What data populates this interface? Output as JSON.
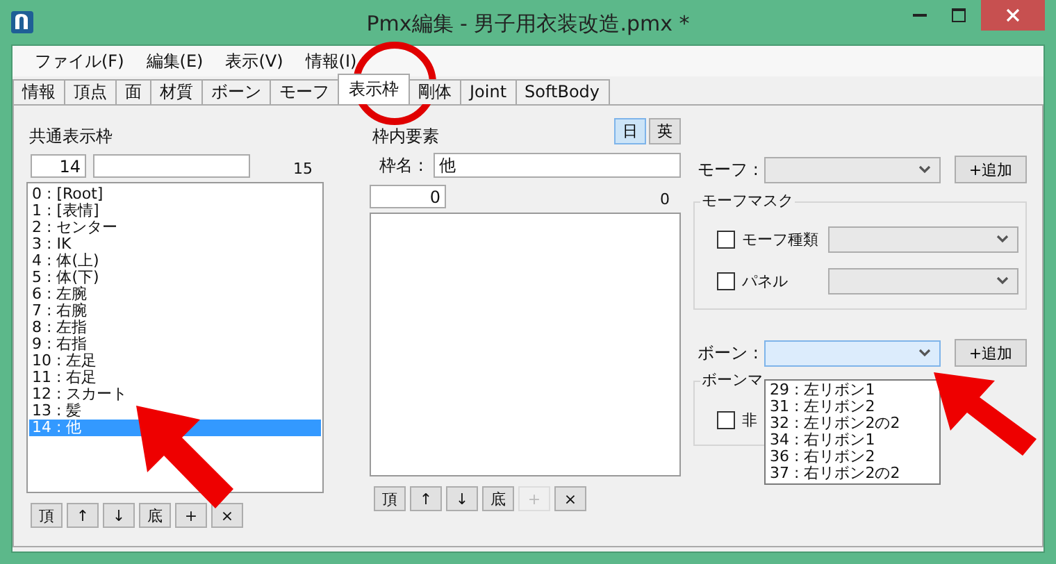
{
  "window": {
    "title": "Pmx編集 - 男子用衣装改造.pmx *"
  },
  "menu": [
    "ファイル(F)",
    "編集(E)",
    "表示(V)",
    "情報(I)"
  ],
  "tabs": [
    {
      "label": "情報",
      "selected": false
    },
    {
      "label": "頂点",
      "selected": false
    },
    {
      "label": "面",
      "selected": false
    },
    {
      "label": "材質",
      "selected": false
    },
    {
      "label": "ボーン",
      "selected": false
    },
    {
      "label": "モーフ",
      "selected": false
    },
    {
      "label": "表示枠",
      "selected": true
    },
    {
      "label": "剛体",
      "selected": false
    },
    {
      "label": "Joint",
      "selected": false
    },
    {
      "label": "SoftBody",
      "selected": false
    }
  ],
  "frame_list": {
    "title": "共通表示枠",
    "index": "14",
    "count": "15",
    "items": [
      {
        "label": "0 : [Root]",
        "selected": false
      },
      {
        "label": "1 : [表情]",
        "selected": false
      },
      {
        "label": "2 : センター",
        "selected": false
      },
      {
        "label": "3 : IK",
        "selected": false
      },
      {
        "label": "4 : 体(上)",
        "selected": false
      },
      {
        "label": "5 : 体(下)",
        "selected": false
      },
      {
        "label": "6 : 左腕",
        "selected": false
      },
      {
        "label": "7 : 右腕",
        "selected": false
      },
      {
        "label": "8 : 左指",
        "selected": false
      },
      {
        "label": "9 : 右指",
        "selected": false
      },
      {
        "label": "10 : 左足",
        "selected": false
      },
      {
        "label": "11 : 右足",
        "selected": false
      },
      {
        "label": "12 : スカート",
        "selected": false
      },
      {
        "label": "13 : 髪",
        "selected": false
      },
      {
        "label": "14 : 他",
        "selected": true
      }
    ],
    "buttons": [
      {
        "label": "頂",
        "disabled": false
      },
      {
        "label": "↑",
        "disabled": false
      },
      {
        "label": "↓",
        "disabled": false
      },
      {
        "label": "底",
        "disabled": false
      },
      {
        "label": "+",
        "disabled": false
      },
      {
        "label": "×",
        "disabled": false
      }
    ]
  },
  "element_list": {
    "title": "枠内要素",
    "lang_buttons": [
      {
        "label": "日",
        "selected": true
      },
      {
        "label": "英",
        "selected": false
      }
    ],
    "name_label": "枠名 :",
    "name_value": "他",
    "index": "0",
    "count": "0",
    "buttons": [
      {
        "label": "頂",
        "disabled": false
      },
      {
        "label": "↑",
        "disabled": false
      },
      {
        "label": "↓",
        "disabled": false
      },
      {
        "label": "底",
        "disabled": false
      },
      {
        "label": "+",
        "disabled": true
      },
      {
        "label": "×",
        "disabled": false
      }
    ]
  },
  "morph": {
    "label": "モーフ :",
    "add": "+追加"
  },
  "morph_mask": {
    "title": "モーフマスク",
    "rows": [
      {
        "label": "モーフ種類",
        "checked": false
      },
      {
        "label": "パネル",
        "checked": false
      }
    ]
  },
  "bone": {
    "label": "ボーン :",
    "add": "+追加",
    "open": true,
    "options": [
      "29 : 左リボン1",
      "31 : 左リボン2",
      "32 : 左リボン2の2",
      "34 : 右リボン1",
      "36 : 右リボン2",
      "37 : 右リボン2の2"
    ]
  },
  "bone_mask": {
    "title": "ボーンマ",
    "rows": [
      {
        "label": "非",
        "checked": false
      }
    ]
  }
}
